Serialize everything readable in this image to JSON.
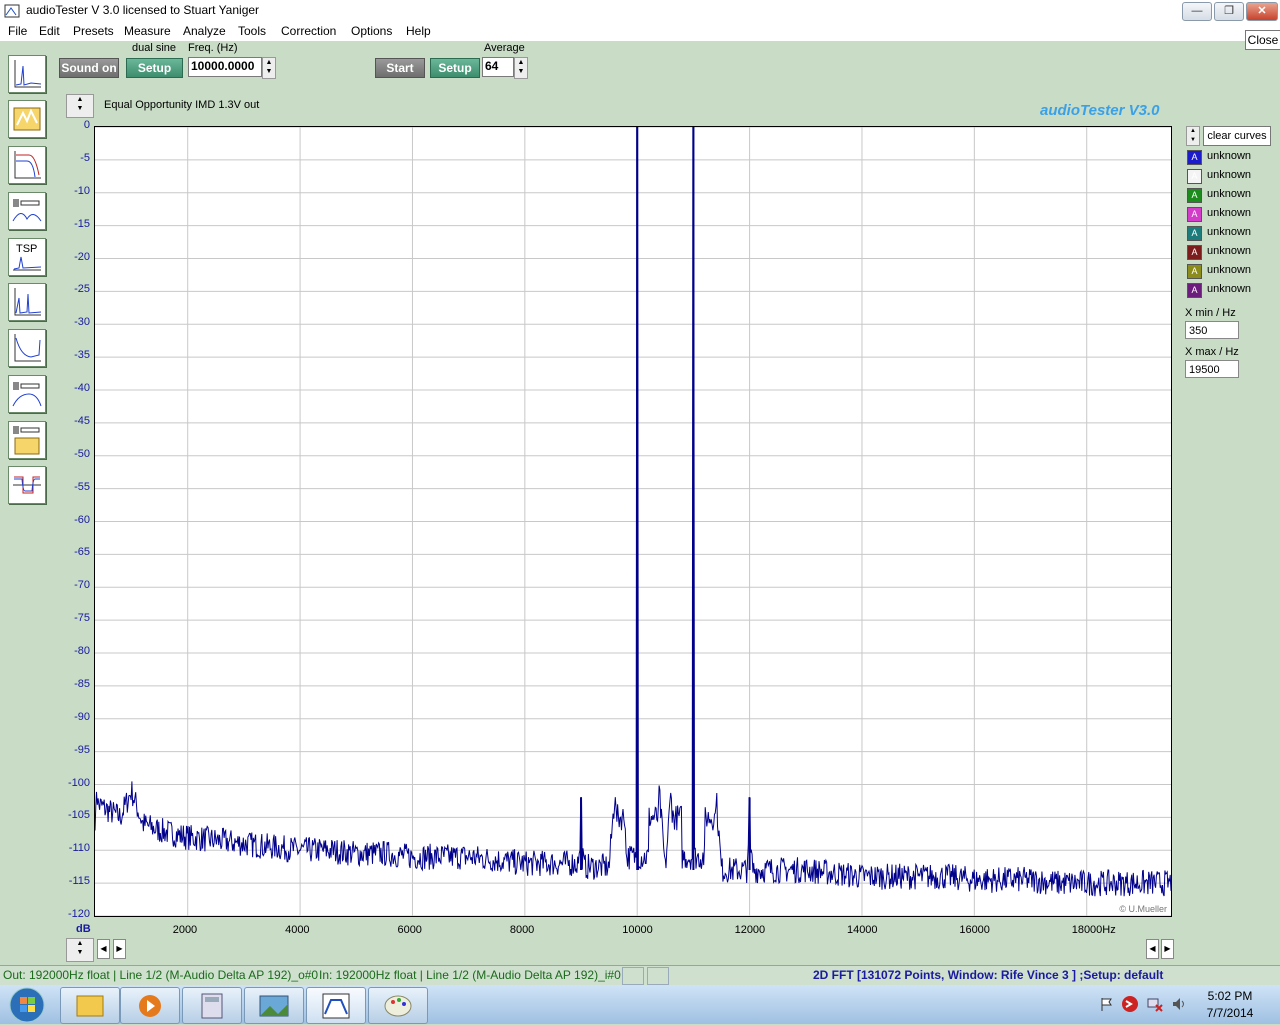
{
  "window": {
    "title": "audioTester  V 3.0   licensed to Stuart Yaniger",
    "close_label": "Close"
  },
  "menu": [
    "File",
    "Edit",
    "Presets",
    "Measure",
    "Analyze",
    "Tools",
    "Correction",
    "Options",
    "Help"
  ],
  "toolbar": {
    "sound_on_label": "Sound on",
    "dual_sine_label": "dual sine",
    "setup_label": "Setup",
    "freq_label": "Freq. (Hz)",
    "freq_value": "10000.0000",
    "start_label": "Start",
    "setup2_label": "Setup",
    "average_label": "Average",
    "average_value": "64"
  },
  "plot": {
    "caption": "Equal Opportunity IMD 1.3V out",
    "brand": "audioTester  V3.0",
    "copyright": "© U.Mueller",
    "y_unit": "dB"
  },
  "right_panel": {
    "clear_label": "clear curves",
    "legend": [
      {
        "label": "unknown",
        "color": "#1c1ccc"
      },
      {
        "label": "unknown",
        "color": "#f4f4f4"
      },
      {
        "label": "unknown",
        "color": "#1c8c1c"
      },
      {
        "label": "unknown",
        "color": "#d23cc8"
      },
      {
        "label": "unknown",
        "color": "#1c7c7c"
      },
      {
        "label": "unknown",
        "color": "#7c1c1c"
      },
      {
        "label": "unknown",
        "color": "#8c8c1c"
      },
      {
        "label": "unknown",
        "color": "#6c1c7c"
      }
    ],
    "xmin_label": "X min / Hz",
    "xmin_value": "350",
    "xmax_label": "X max / Hz",
    "xmax_value": "19500"
  },
  "status": {
    "out": "Out: 192000Hz float  | Line 1/2 (M-Audio Delta AP 192)_o#0",
    "in": "In: 192000Hz float  | Line 1/2 (M-Audio Delta AP 192)_i#0",
    "fft": "2D FFT [131072 Points, Window: Rife Vince 3 ]  ;Setup:  default"
  },
  "taskbar": {
    "time": "5:02 PM",
    "date": "7/7/2014"
  },
  "chart_data": {
    "type": "line",
    "title": "Equal Opportunity IMD 1.3V out",
    "xlabel": "Hz",
    "ylabel": "dB",
    "xlim": [
      350,
      19500
    ],
    "ylim": [
      -120,
      0
    ],
    "x_ticks": [
      "2000",
      "4000",
      "6000",
      "8000",
      "10000",
      "12000",
      "14000",
      "16000",
      "18000Hz"
    ],
    "y_ticks": [
      "0",
      "-5",
      "-10",
      "-15",
      "-20",
      "-25",
      "-30",
      "-35",
      "-40",
      "-45",
      "-50",
      "-55",
      "-60",
      "-65",
      "-70",
      "-75",
      "-80",
      "-85",
      "-90",
      "-95",
      "-100",
      "-105",
      "-110",
      "-115",
      "-120"
    ],
    "grid": true,
    "series": [
      {
        "color": "#00008b",
        "x": [
          350,
          400,
          600,
          800,
          1000,
          1200,
          1500,
          2000,
          2500,
          3000,
          3500,
          4000,
          4500,
          5000,
          5500,
          6000,
          6500,
          7000,
          7500,
          8000,
          8500,
          8950,
          9000,
          9050,
          9500,
          9990,
          10000,
          10010,
          10500,
          10990,
          11000,
          11010,
          11500,
          11950,
          12000,
          12050,
          12500,
          13000,
          13500,
          14000,
          14500,
          15000,
          15500,
          16000,
          16500,
          17000,
          17500,
          18000,
          18500,
          19000,
          19500
        ],
        "y": [
          -97,
          -103,
          -104,
          -105,
          -101,
          -106,
          -107,
          -108,
          -108.5,
          -109,
          -109.5,
          -110,
          -110,
          -110.5,
          -110.5,
          -111,
          -111,
          -111,
          -111.5,
          -112,
          -112,
          -112,
          -102,
          -112.5,
          -112.5,
          -60,
          0,
          -60,
          -113,
          -55,
          0,
          -55,
          -113,
          -113,
          -102,
          -113,
          -113,
          -113,
          -113.5,
          -114,
          -114,
          -114,
          -114,
          -114.5,
          -114.5,
          -114.5,
          -115,
          -115,
          -115,
          -115,
          -115
        ]
      }
    ],
    "peaks": [
      {
        "x": 9000,
        "y": -102
      },
      {
        "x": 10000,
        "y": 0
      },
      {
        "x": 11000,
        "y": 0
      },
      {
        "x": 12000,
        "y": -102
      }
    ]
  }
}
